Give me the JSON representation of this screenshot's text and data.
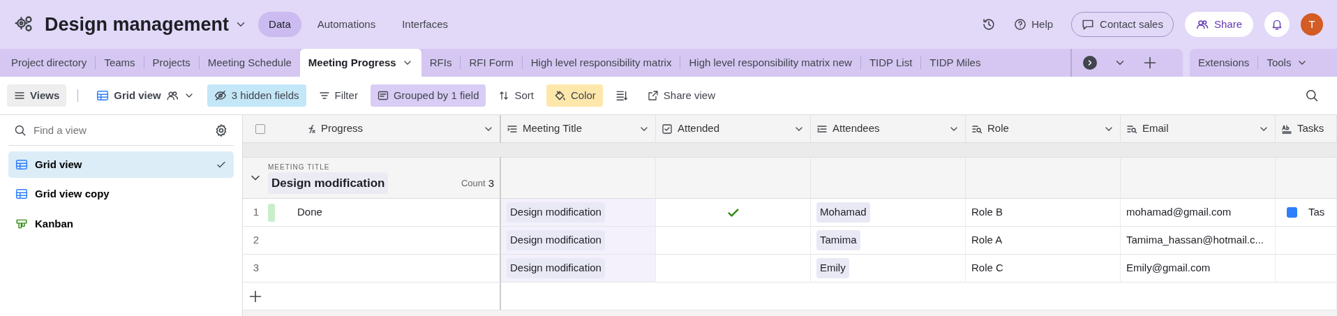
{
  "base": {
    "title": "Design management"
  },
  "top_nav": [
    {
      "label": "Data",
      "selected": true
    },
    {
      "label": "Automations",
      "selected": false
    },
    {
      "label": "Interfaces",
      "selected": false
    }
  ],
  "header_actions": {
    "help": "Help",
    "contact": "Contact sales",
    "share": "Share",
    "avatar": "T"
  },
  "tables": [
    {
      "label": "Project directory",
      "selected": false
    },
    {
      "label": "Teams",
      "selected": false
    },
    {
      "label": "Projects",
      "selected": false
    },
    {
      "label": "Meeting Schedule",
      "selected": false
    },
    {
      "label": "Meeting Progress",
      "selected": true
    },
    {
      "label": "RFIs",
      "selected": false
    },
    {
      "label": "RFI Form",
      "selected": false
    },
    {
      "label": "High level responsibility matrix",
      "selected": false
    },
    {
      "label": "High level responsibility matrix new",
      "selected": false
    },
    {
      "label": "TIDP List",
      "selected": false
    },
    {
      "label": "TIDP Miles",
      "selected": false
    }
  ],
  "right_tabs": [
    "Extensions",
    "Tools"
  ],
  "toolbar": {
    "views": "Views",
    "view_name": "Grid view",
    "hidden_fields": "3 hidden fields",
    "filter": "Filter",
    "group": "Grouped by 1 field",
    "sort": "Sort",
    "color_label": "Color",
    "share_view": "Share view"
  },
  "sidebar": {
    "search_placeholder": "Find a view",
    "views": [
      {
        "label": "Grid view",
        "kind": "grid",
        "selected": true
      },
      {
        "label": "Grid view copy",
        "kind": "grid",
        "selected": false
      },
      {
        "label": "Kanban",
        "kind": "kanban",
        "selected": false
      }
    ]
  },
  "grid": {
    "select_all_checked": false,
    "columns": [
      {
        "label": "Progress",
        "kind": "formula"
      },
      {
        "label": "Meeting Title",
        "kind": "longtext"
      },
      {
        "label": "Attended",
        "kind": "checkbox"
      },
      {
        "label": "Attendees",
        "kind": "link"
      },
      {
        "label": "Role",
        "kind": "lookup"
      },
      {
        "label": "Email",
        "kind": "lookup"
      },
      {
        "label": "Tasks",
        "kind": "text"
      }
    ],
    "group": {
      "label": "MEETING TITLE",
      "value": "Design modification",
      "count_label": "Count",
      "count": "3"
    },
    "rows": [
      {
        "number": "1",
        "color": "#c9efca",
        "progress": "Done",
        "meeting_title": "Design modification",
        "attended": true,
        "attendees": "Mohamad",
        "role": "Role B",
        "email": "mohamad@gmail.com",
        "tasks": {
          "checked": true,
          "text": "Tas"
        }
      },
      {
        "number": "2",
        "meeting_title": "Design modification",
        "attended": false,
        "attendees": "Tamima",
        "role": "Role A",
        "email": "Tamima_hassan@hotmail.c..."
      },
      {
        "number": "3",
        "meeting_title": "Design modification",
        "attended": false,
        "attendees": "Emily",
        "role": "Role C",
        "email": "Emily@gmail.com"
      }
    ]
  }
}
